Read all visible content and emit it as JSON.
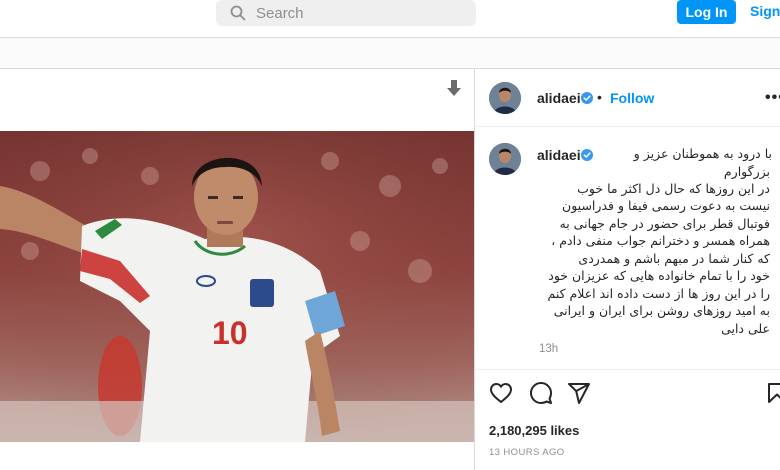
{
  "header": {
    "search_placeholder": "Search",
    "login_label": "Log In",
    "signup_label": "Sign"
  },
  "post": {
    "username": "alidaei",
    "follow_label": "Follow",
    "more_label": "•••",
    "dot": "•",
    "caption_lines": [
      "با درود به هموطنان عزیز و",
      "بزرگوارم",
      "در این روزها که حال دل اکثر ما خوب",
      "نیست به دعوت رسمی فیفا و فدراسیون",
      "فوتبال قطر برای حضور در جام جهانی به",
      "همراه همسر و دخترانم جواب منفی دادم ،",
      "که کنار شما در مبهم باشم و همدردی",
      "خود را با تمام خانواده هایی که عزیزان خود",
      "را در این روز ها از دست داده اند اعلام کنم",
      "به امید روزهای روشن برای ایران و ایرانی",
      "علی دایی"
    ],
    "caption_time": "13h",
    "likes": "2,180,295 likes",
    "time_ago": "13 HOURS AGO",
    "jersey_number": "10"
  },
  "icons": {
    "search": "search-icon",
    "download": "download-icon",
    "verified": "verified-badge-icon",
    "like": "heart-icon",
    "comment": "comment-icon",
    "share": "send-icon",
    "save": "bookmark-icon"
  },
  "colors": {
    "accent": "#0095f6",
    "muted": "#8e8e8e",
    "text": "#262626"
  }
}
